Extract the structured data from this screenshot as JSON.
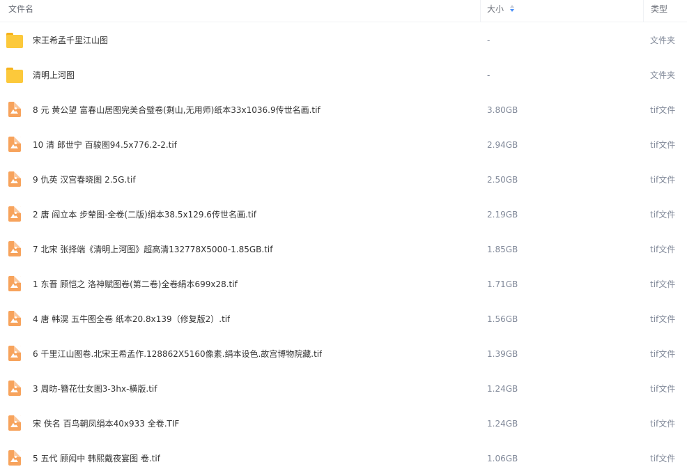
{
  "header": {
    "name_label": "文件名",
    "size_label": "大小",
    "type_label": "类型"
  },
  "files": [
    {
      "icon": "folder-icon",
      "name": "宋王希孟千里江山图",
      "size": "-",
      "type": "文件夹"
    },
    {
      "icon": "folder-icon",
      "name": "清明上河图",
      "size": "-",
      "type": "文件夹"
    },
    {
      "icon": "image-file-icon",
      "name": "8 元 黄公望 富春山居图完美合璧卷(剩山,无用师)纸本33x1036.9传世名画.tif",
      "size": "3.80GB",
      "type": "tif文件"
    },
    {
      "icon": "image-file-icon",
      "name": "10 清 郎世宁 百骏图94.5x776.2-2.tif",
      "size": "2.94GB",
      "type": "tif文件"
    },
    {
      "icon": "image-file-icon",
      "name": "9 仇英 汉宫春晓图 2.5G.tif",
      "size": "2.50GB",
      "type": "tif文件"
    },
    {
      "icon": "image-file-icon",
      "name": "2 唐 阎立本 步辇图-全卷(二版)绢本38.5x129.6传世名画.tif",
      "size": "2.19GB",
      "type": "tif文件"
    },
    {
      "icon": "image-file-icon",
      "name": "7 北宋 张择端《清明上河图》超高清132778X5000-1.85GB.tif",
      "size": "1.85GB",
      "type": "tif文件"
    },
    {
      "icon": "image-file-icon",
      "name": "1 东晋 顾恺之 洛神赋图卷(第二卷)全卷绢本699x28.tif",
      "size": "1.71GB",
      "type": "tif文件"
    },
    {
      "icon": "image-file-icon",
      "name": "4 唐 韩滉 五牛图全卷 纸本20.8x139（修复版2）.tif",
      "size": "1.56GB",
      "type": "tif文件"
    },
    {
      "icon": "image-file-icon",
      "name": "6 千里江山图卷.北宋王希孟作.128862X5160像素.绢本设色.故宫博物院藏.tif",
      "size": "1.39GB",
      "type": "tif文件"
    },
    {
      "icon": "image-file-icon",
      "name": "3 周昉-簪花仕女图3-3hx-横版.tif",
      "size": "1.24GB",
      "type": "tif文件"
    },
    {
      "icon": "image-file-icon",
      "name": "宋 佚名 百鸟朝凤绢本40x933 全卷.TIF",
      "size": "1.24GB",
      "type": "tif文件"
    },
    {
      "icon": "image-file-icon",
      "name": "5 五代 顾闳中 韩熙戴夜宴图 卷.tif",
      "size": "1.06GB",
      "type": "tif文件"
    }
  ]
}
